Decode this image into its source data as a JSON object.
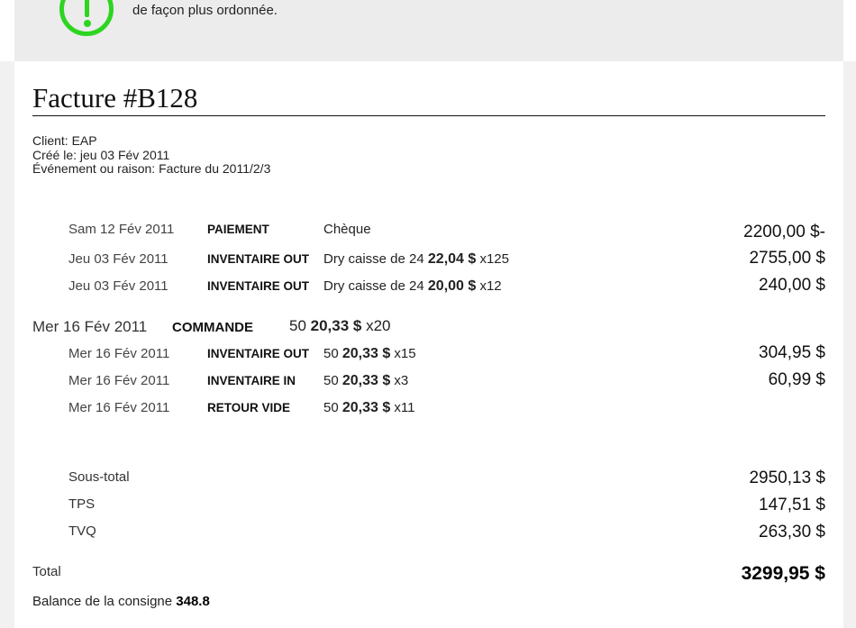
{
  "notice": {
    "line1": "de façon plus ordonnée.",
    "line0": "",
    "icon": "exclamation-circle-icon",
    "icon_color": "#2dd520"
  },
  "invoice": {
    "title": "Facture #B128",
    "client": "Client: EAP",
    "created": "Créé le: jeu 03 Fév 2011",
    "reason": "Événement ou raison: Facture du 2011/2/3"
  },
  "transactions": [
    {
      "date": "Sam 12 Fév 2011",
      "type": "PAIEMENT",
      "desc_text": "Chèque",
      "desc_bold": "",
      "desc_suffix": "",
      "amount": "2200,00 $-"
    },
    {
      "date": "Jeu 03 Fév 2011",
      "type": "INVENTAIRE OUT",
      "desc_text": "Dry caisse de 24 ",
      "desc_bold": "22,04 $",
      "desc_suffix": " x125",
      "amount": "2755,00 $"
    },
    {
      "date": "Jeu 03 Fév 2011",
      "type": "INVENTAIRE OUT",
      "desc_text": "Dry caisse de 24 ",
      "desc_bold": "20,00 $",
      "desc_suffix": " x12",
      "amount": "240,00 $"
    }
  ],
  "order": {
    "date": "Mer 16 Fév 2011",
    "type": "COMMANDE",
    "desc_text": "50 ",
    "desc_bold": "20,33 $",
    "desc_suffix": " x20",
    "items": [
      {
        "date": "Mer 16 Fév 2011",
        "type": "INVENTAIRE OUT",
        "desc_text": "50 ",
        "desc_bold": "20,33 $",
        "desc_suffix": " x15",
        "amount": "304,95 $"
      },
      {
        "date": "Mer 16 Fév 2011",
        "type": "INVENTAIRE IN",
        "desc_text": "50 ",
        "desc_bold": "20,33 $",
        "desc_suffix": " x3",
        "amount": "60,99 $"
      },
      {
        "date": "Mer 16 Fév 2011",
        "type": "RETOUR VIDE",
        "desc_text": "50 ",
        "desc_bold": "20,33 $",
        "desc_suffix": " x11",
        "amount": ""
      }
    ]
  },
  "summary": {
    "subtotal_label": "Sous-total",
    "subtotal": "2950,13 $",
    "tps_label": "TPS",
    "tps": "147,51 $",
    "tvq_label": "TVQ",
    "tvq": "263,30 $",
    "total_label": "Total",
    "total": "3299,95 $",
    "balance_label": "Balance de la consigne ",
    "balance": "348.8"
  }
}
